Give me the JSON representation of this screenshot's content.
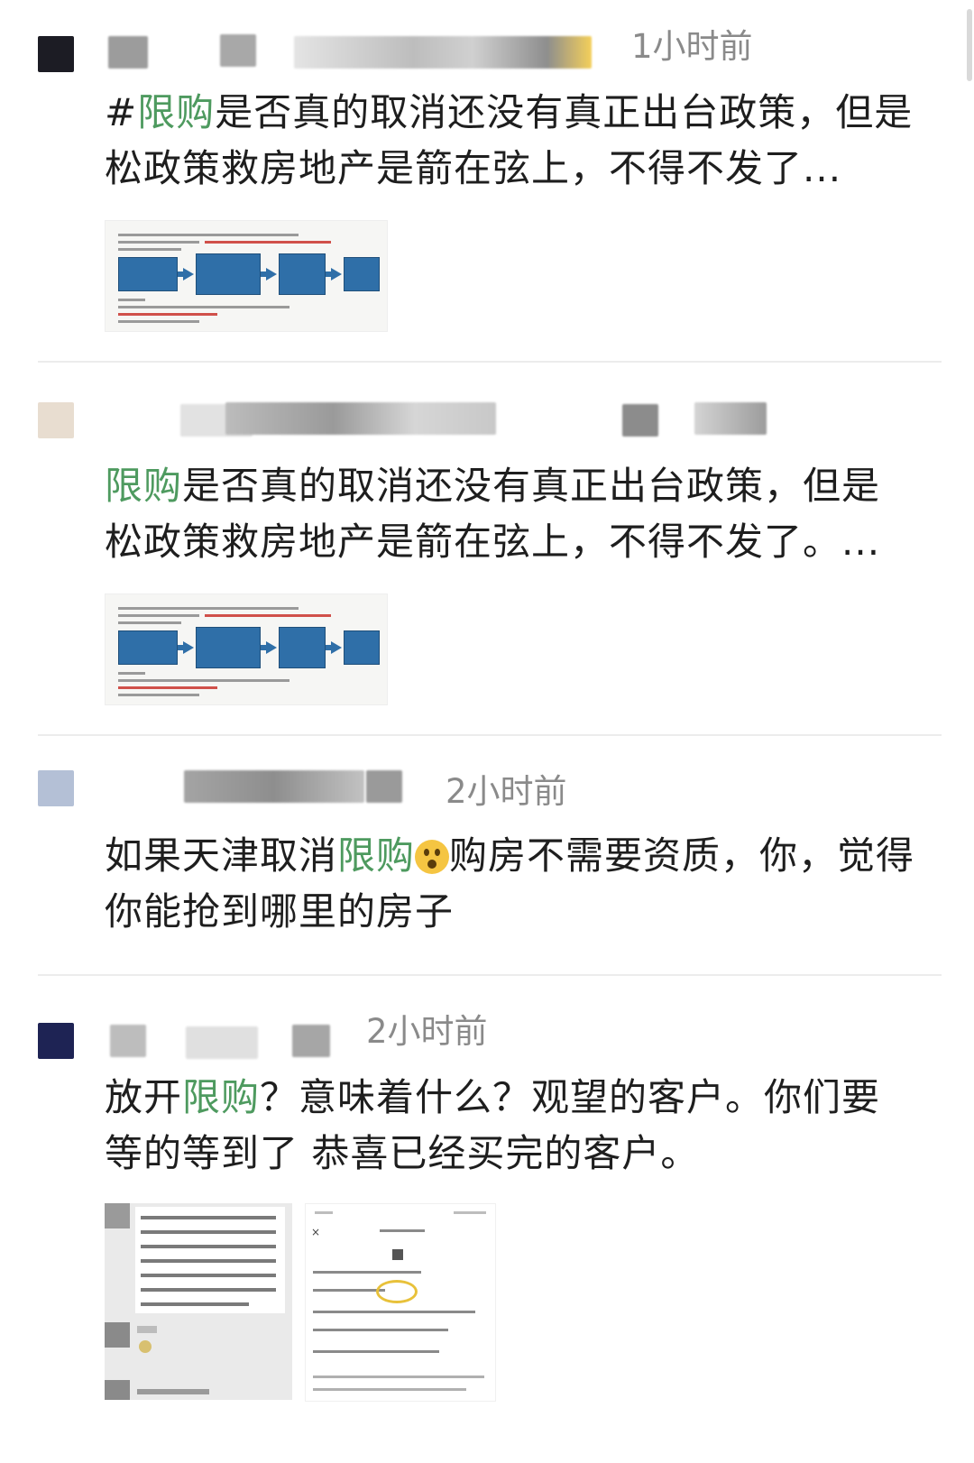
{
  "comments": [
    {
      "time": "1小时前",
      "text_prefix": "#",
      "tag": "限购",
      "text_rest": "是否真的取消还没有真正出台政策，但是松政策救房地产是箭在弦上，不得不发了..."
    },
    {
      "time": "",
      "text_prefix": "",
      "tag": "限购",
      "text_rest": "是否真的取消还没有真正出台政策，但是松政策救房地产是箭在弦上，不得不发了。..."
    },
    {
      "time": "2小时前",
      "text_prefix": "如果天津取消",
      "tag": "限购",
      "text_rest": "购房不需要资质，你，觉得你能抢到哪里的房子",
      "emoji": "astonished-emoji"
    },
    {
      "time": "2小时前",
      "text_prefix": "放开",
      "tag": "限购",
      "text_rest": "？意味着什么？观望的客户。你们要等的等到了 恭喜已经买完的客户。"
    }
  ],
  "colors": {
    "tag": "#4e9a5f",
    "time": "#8a8a8a",
    "flow_box": "#2f6fa8"
  }
}
